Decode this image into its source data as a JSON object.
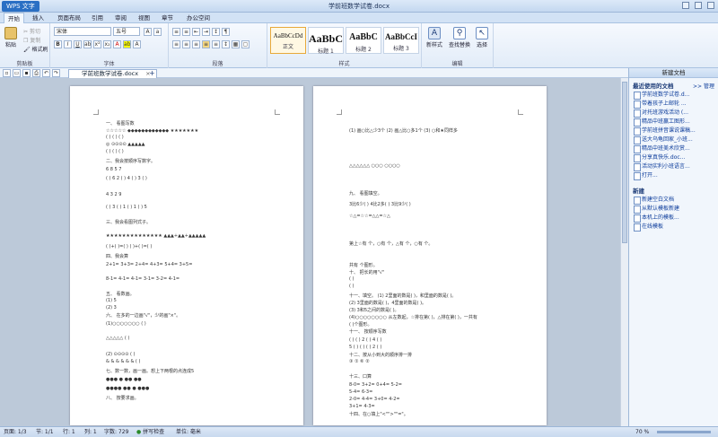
{
  "app": {
    "menu_label": "WPS 文字",
    "window_title": "学前班数学试卷.docx"
  },
  "tabs": [
    "开始",
    "插入",
    "页面布局",
    "引用",
    "审阅",
    "视图",
    "章节",
    "办公空间"
  ],
  "ribbon": {
    "clipboard": {
      "paste": "粘贴",
      "cut": "剪切",
      "copy": "复制",
      "format_painter": "格式刷",
      "label": "剪贴板"
    },
    "font": {
      "name": "宋体",
      "size": "五号",
      "label": "字体"
    },
    "paragraph": {
      "label": "段落"
    },
    "styles": {
      "items": [
        {
          "sample": "AaBbCcDd",
          "name": "正文"
        },
        {
          "sample": "AaBbC",
          "name": "标题 1"
        },
        {
          "sample": "AaBbC",
          "name": "标题 2"
        },
        {
          "sample": "AaBbCcI",
          "name": "标题 3"
        }
      ],
      "label": "样式"
    },
    "editing": {
      "new_style": "新样式",
      "find_replace": "查找替换",
      "select": "选择",
      "label": "编辑"
    }
  },
  "document_tab": {
    "name": "学前班数学试卷.docx"
  },
  "page1_lines": [
    "一、  看图写数",
    "☆☆☆☆☆   ◆◆◆◆◆◆◆◆◆◆◆◆   ★★★★★★★",
    "(         )           (         )          (         )",
    "◎   ⊙⊙⊙⊙                                 ▲▲▲▲▲",
    "(         )           (         )          (         )",
    "二、我会按顺序写数字。",
    "      6             8               5               7",
    "(  )    6      2  (  )    4  (  )    3  (  )",
    "      4             3              2              9",
    "(  )    3     (  )    1     (  )    1     (  )    5",
    "三、我会看图列式子。",
    "★★★★★★★★★★★★★★       ▲▲▲+▲▲+▲▲▲▲▲",
    "(  )+(  )=(  )               (  )+(  )=(  )",
    "四、我会算",
    "2+1=       3+3=       2+4=       4+3=       5+4=      3+5=",
    "8-1=       4-1=       4-1=       3-1=       3-2=      4-1=",
    "五、  看数画。",
    "(1) 5",
    "(2) 3",
    "六、  在多的一边画\"√\"，少的画\"×\"。",
    "(1)○○○○○○○                (         )",
    "△△△△△               (         )",
    "(2) ⊙⊙⊙⊙             (         )",
    "& & & & & &          (         )",
    "七、数一数，画一画。想上下两根的点连成5",
    "●●●                ●                    ●●                 ●●",
    "●●●●               ●●                   ●                  ●●●",
    "八、  按要求画。"
  ],
  "page2_lines": [
    "(1) 画○比△少3个     (2) 画△比○多1个       (3) ○和★同样多",
    "△△△△△△               ○○○                       ○○○○",
    "九、  看图填空。",
    "3比6少(    )          4比2多(    )         3比9少(    )",
    "☆△=☆☆=△△=☆△",
    "      第上☆有        个，○有         个，△有          个，○有          个。",
    "共有                      个图形。",
    "十、  把长的用\"√\"",
    "(                                    )",
    "(                                    )",
    "十一、填空。       (1) 2里面的数是(    )，和里面的数是(    )。",
    "(2) 3里面的数是(      )，4里面的数是(      )。",
    "(3) 3和5之间的数是(     )。",
    "(4)○○○○○○○○     从左数起，☆排在第(    )，△排在第(    )，一共有",
    "(      )个图形。",
    "十一、  按顺序写数",
    "(    )  (    )  2  (    )  4  (    )",
    "5  (    )  (    )  (    )  2 (    )",
    "十二、按从小到大的顺序排一排",
    "③    ①    ⑥    ②",
    "十三、口算",
    "8-0=              3+2=              0+4=              5-2=",
    "5-4=              6-3=",
    "2-0=              4-4=              3+0=              4-2=",
    "3+1=                      4-3=",
    "十四、在○填上\"<\"\">\"\"=\"。"
  ],
  "task_pane": {
    "title": "新建文档",
    "recent_label": "最近使用的文档",
    "manage_label": ">> 管理",
    "recent_docs": [
      "学前班数学试卷.d...",
      "带着孩子上邮轮 ...",
      "对托班游戏活动 (...",
      "精品中班赢工图形...",
      "学前班拼音课说课稿...",
      "送大乌龟回家_小班...",
      "精品中班美术欣赏...",
      "分享真快乐.doc...",
      "活动实利小班语言..."
    ],
    "open_label": "打开...",
    "new_label": "新建",
    "new_items": [
      "新建空白文档",
      "从默认模板新建",
      "本机上的模板...",
      "在线模板"
    ]
  },
  "status": {
    "page": "页面: 1/3",
    "section": "节: 1/1",
    "line": "行: 1",
    "column": "列: 1",
    "words": "字数: 729",
    "spell": "拼写检查",
    "unit": "单位: 毫米",
    "zoom": "70 %"
  }
}
